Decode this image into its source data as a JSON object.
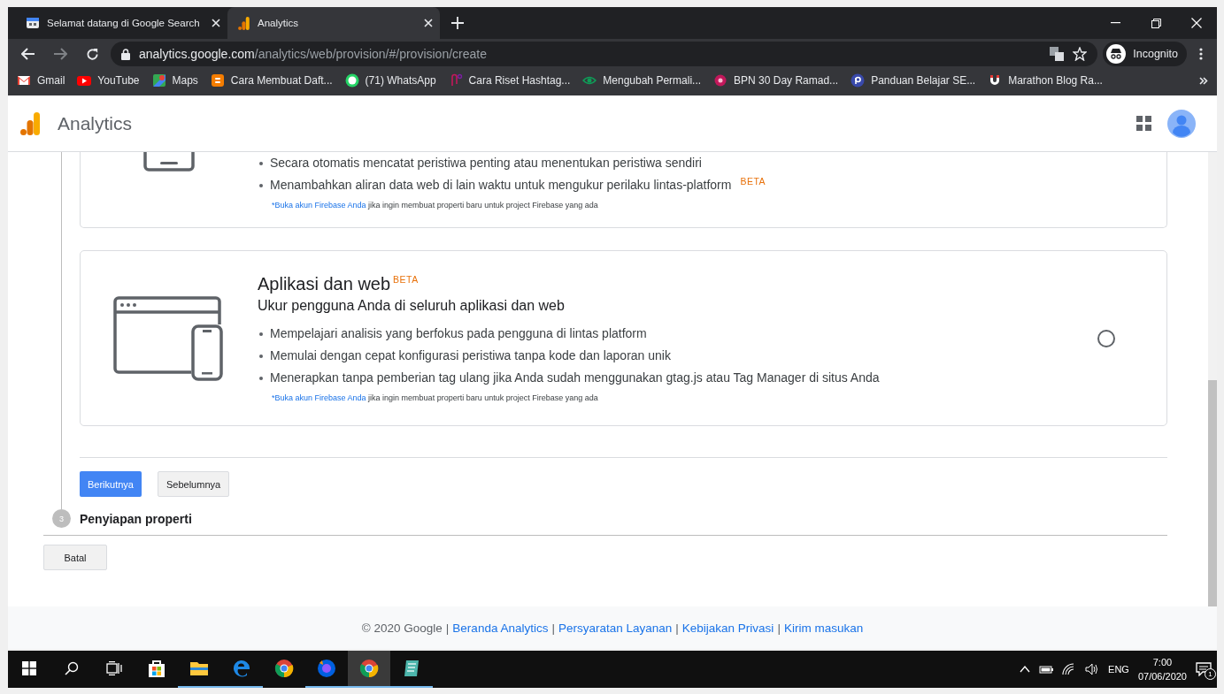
{
  "browser": {
    "tabs": [
      {
        "title": "Selamat datang di Google Search",
        "kind": "calendar",
        "selected": false
      },
      {
        "title": "Analytics",
        "kind": "bars",
        "selected": true
      }
    ],
    "url": {
      "domain": "analytics.google.com",
      "path": "/analytics/web/provision/#/provision/create"
    },
    "profile": "Incognito",
    "bookmarks": [
      {
        "label": "Gmail",
        "kind": "mail"
      },
      {
        "label": "YouTube",
        "kind": "play"
      },
      {
        "label": "Maps",
        "kind": "map"
      },
      {
        "label": "Cara Membuat Daft...",
        "kind": "blog"
      },
      {
        "label": "(71) WhatsApp",
        "kind": "chat"
      },
      {
        "label": "Cara Riset Hashtag...",
        "kind": "clip"
      },
      {
        "label": "Mengubah Permali...",
        "kind": "eye"
      },
      {
        "label": "BPN 30 Day Ramad...",
        "kind": "dot"
      },
      {
        "label": "Panduan Belajar SE...",
        "kind": "pcircle"
      },
      {
        "label": "Marathon Blog Ra...",
        "kind": "magnet"
      }
    ]
  },
  "app": {
    "title": "Analytics"
  },
  "cards": [
    {
      "kind": "partial",
      "bullets": [
        {
          "text": "Secara otomatis mencatat peristiwa penting atau menentukan peristiwa sendiri"
        },
        {
          "text": "Menambahkan aliran data web di lain waktu untuk mengukur perilaku lintas-platform",
          "badge": "BETA"
        }
      ],
      "note": {
        "link": "*Buka akun Firebase Anda",
        "text": "jika ingin membuat properti baru untuk project Firebase yang ada"
      }
    },
    {
      "kind": "full",
      "selected": false,
      "title": "Aplikasi dan web",
      "badge": "BETA",
      "subtitle": "Ukur pengguna Anda di seluruh aplikasi dan web",
      "bullets": [
        {
          "text": "Mempelajari analisis yang berfokus pada pengguna di lintas platform"
        },
        {
          "text": "Memulai dengan cepat konfigurasi peristiwa tanpa kode dan laporan unik"
        },
        {
          "text": "Menerapkan tanpa pemberian tag ulang jika Anda sudah menggunakan gtag.js atau Tag Manager di situs Anda"
        }
      ],
      "note": {
        "link": "*Buka akun Firebase Anda",
        "text": "jika ingin membuat properti baru untuk project Firebase yang ada"
      }
    }
  ],
  "buttons": {
    "next": "Berikutnya",
    "previous": "Sebelumnya"
  },
  "step": {
    "number": "3",
    "label": "Penyiapan properti"
  },
  "cancel": "Batal",
  "footer": [
    {
      "kind": "text",
      "text": "© 2020 Google"
    },
    {
      "kind": "separator",
      "text": "|"
    },
    {
      "kind": "link",
      "text": "Beranda Analytics"
    },
    {
      "kind": "separator",
      "text": "|"
    },
    {
      "kind": "link",
      "text": "Persyaratan Layanan"
    },
    {
      "kind": "separator",
      "text": "|"
    },
    {
      "kind": "link",
      "text": "Kebijakan Privasi"
    },
    {
      "kind": "separator",
      "text": "|"
    },
    {
      "kind": "link",
      "text": "Kirim masukan"
    }
  ],
  "taskbar": {
    "apps": [
      {
        "kind": "store",
        "running": false,
        "selected": false
      },
      {
        "kind": "folder",
        "running": true,
        "selected": false
      },
      {
        "kind": "edge",
        "running": true,
        "selected": false
      },
      {
        "kind": "chrome",
        "running": false,
        "selected": false
      },
      {
        "kind": "fox",
        "running": true,
        "selected": false
      },
      {
        "kind": "chrome",
        "running": true,
        "selected": true
      },
      {
        "kind": "notepad",
        "running": true,
        "selected": false
      }
    ],
    "language": "ENG",
    "time": "7:00",
    "date": "07/06/2020",
    "notifications": "1"
  }
}
